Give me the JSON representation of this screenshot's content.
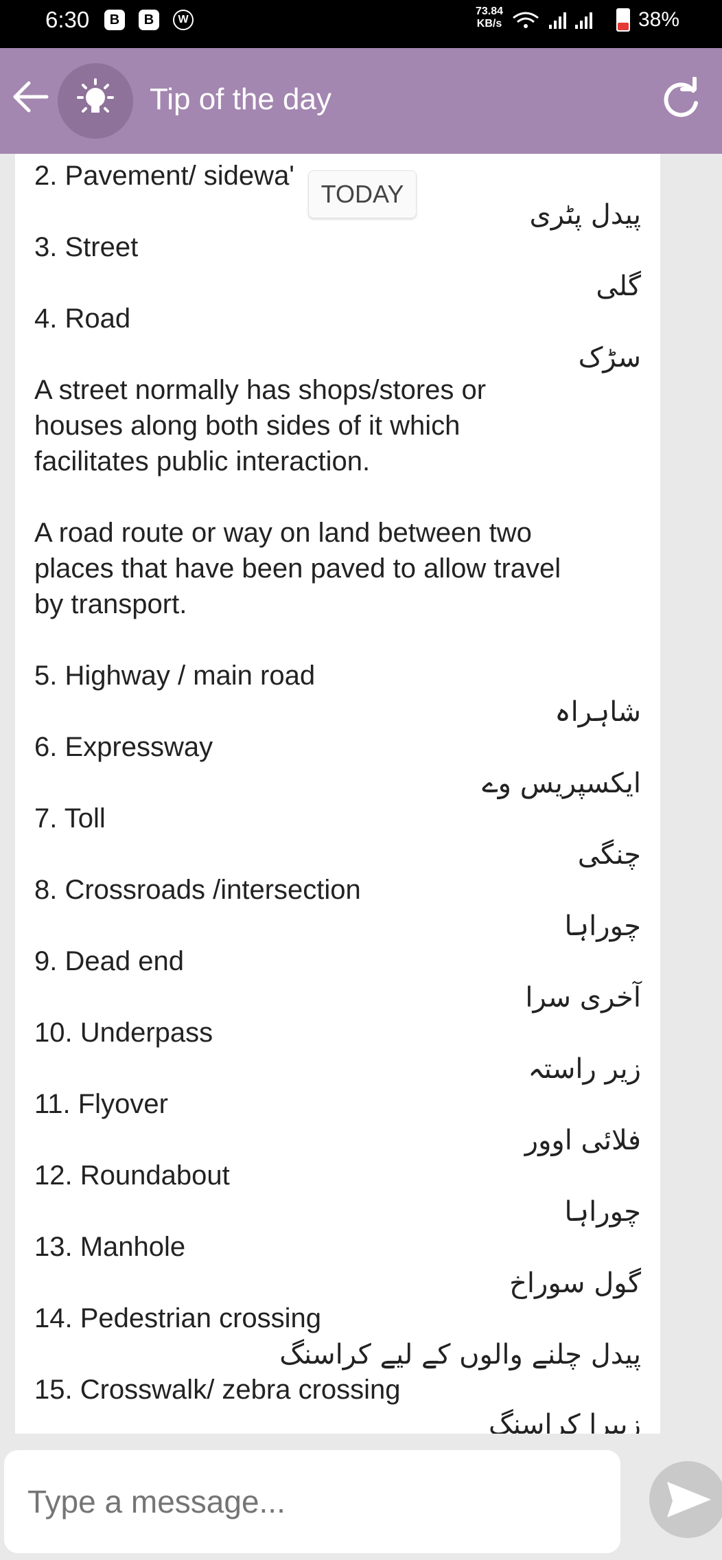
{
  "status_bar": {
    "time": "6:30",
    "notification_icons": [
      "B",
      "B",
      "W"
    ],
    "network_speed_value": "73.84",
    "network_speed_unit": "KB/s",
    "battery_percent": "38%",
    "battery_level": 0.38
  },
  "header": {
    "title": "Tip of the day",
    "icons": [
      "back-arrow-icon",
      "lightbulb-icon",
      "refresh-icon"
    ],
    "background_color": "#a387b0"
  },
  "date_chip": "TODAY",
  "message": {
    "lines": [
      "2. Pavement/ sidewa'",
      "پیدل پٹری",
      "3. Street",
      "گلی",
      "4. Road",
      "سڑک",
      "A street normally has shops/stores or",
      "houses along both sides of it which",
      "facilitates public interaction.",
      "A road route or way on land between two",
      "places that have been paved to allow travel",
      "by transport.",
      "5. Highway / main road",
      "شاہراہ",
      "6. Expressway",
      "ایکسپریس وے",
      "7. Toll",
      "چنگی",
      "8. Crossroads /intersection",
      "چوراہا",
      "9. Dead end",
      "آخری سرا",
      "10. Underpass",
      "زیر راستہ",
      "11. Flyover",
      "فلائی اوور",
      "12. Roundabout",
      "چوراہا",
      "13. Manhole",
      "گول سوراخ",
      "14. Pedestrian crossing",
      "پیدل چلنے والوں کے لیے کراسنگ",
      "15. Crosswalk/ zebra crossing",
      "زیبرا کراسنگ"
    ]
  },
  "composer": {
    "placeholder": "Type a message..."
  }
}
